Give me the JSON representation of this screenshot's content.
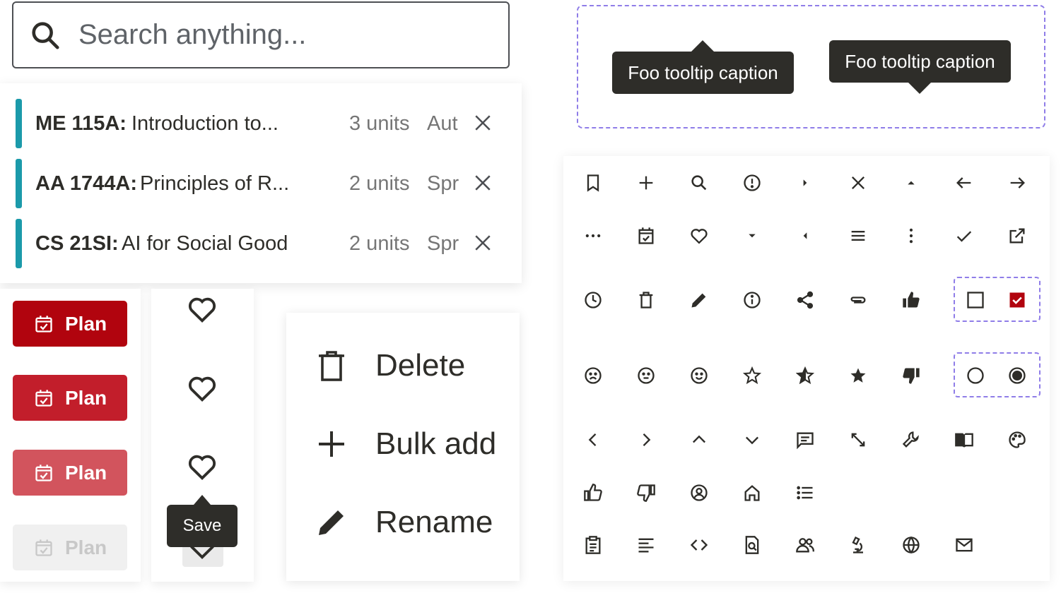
{
  "search": {
    "placeholder": "Search anything..."
  },
  "courses": [
    {
      "code": "ME 115A:",
      "title": "Introduction to...",
      "units": "3 units",
      "term": "Aut"
    },
    {
      "code": "AA 1744A:",
      "title": "Principles of R...",
      "units": "2 units",
      "term": "Spr"
    },
    {
      "code": "CS 21SI:",
      "title": "AI for Social Good",
      "units": "2 units",
      "term": "Spr"
    }
  ],
  "plan_buttons": [
    {
      "label": "Plan",
      "state": "default",
      "color": "#b1040e"
    },
    {
      "label": "Plan",
      "state": "hover",
      "color": "#c21e2b"
    },
    {
      "label": "Plan",
      "state": "active",
      "color": "#d2545d"
    },
    {
      "label": "Plan",
      "state": "disabled",
      "color": "#f0f0f0"
    }
  ],
  "hearts": {
    "tooltip": "Save"
  },
  "menu": {
    "items": [
      {
        "label": "Delete",
        "icon": "trash-icon"
      },
      {
        "label": "Bulk add",
        "icon": "plus-icon"
      },
      {
        "label": "Rename",
        "icon": "pencil-icon"
      }
    ]
  },
  "tooltips": {
    "top_arrow": "Foo tooltip caption",
    "bottom_arrow": "Foo tooltip caption"
  },
  "colors": {
    "accent_teal": "#1b9aaa",
    "brand_red": "#b1040e",
    "dashed_purple": "#8f7de8",
    "dark": "#2e2d29"
  }
}
